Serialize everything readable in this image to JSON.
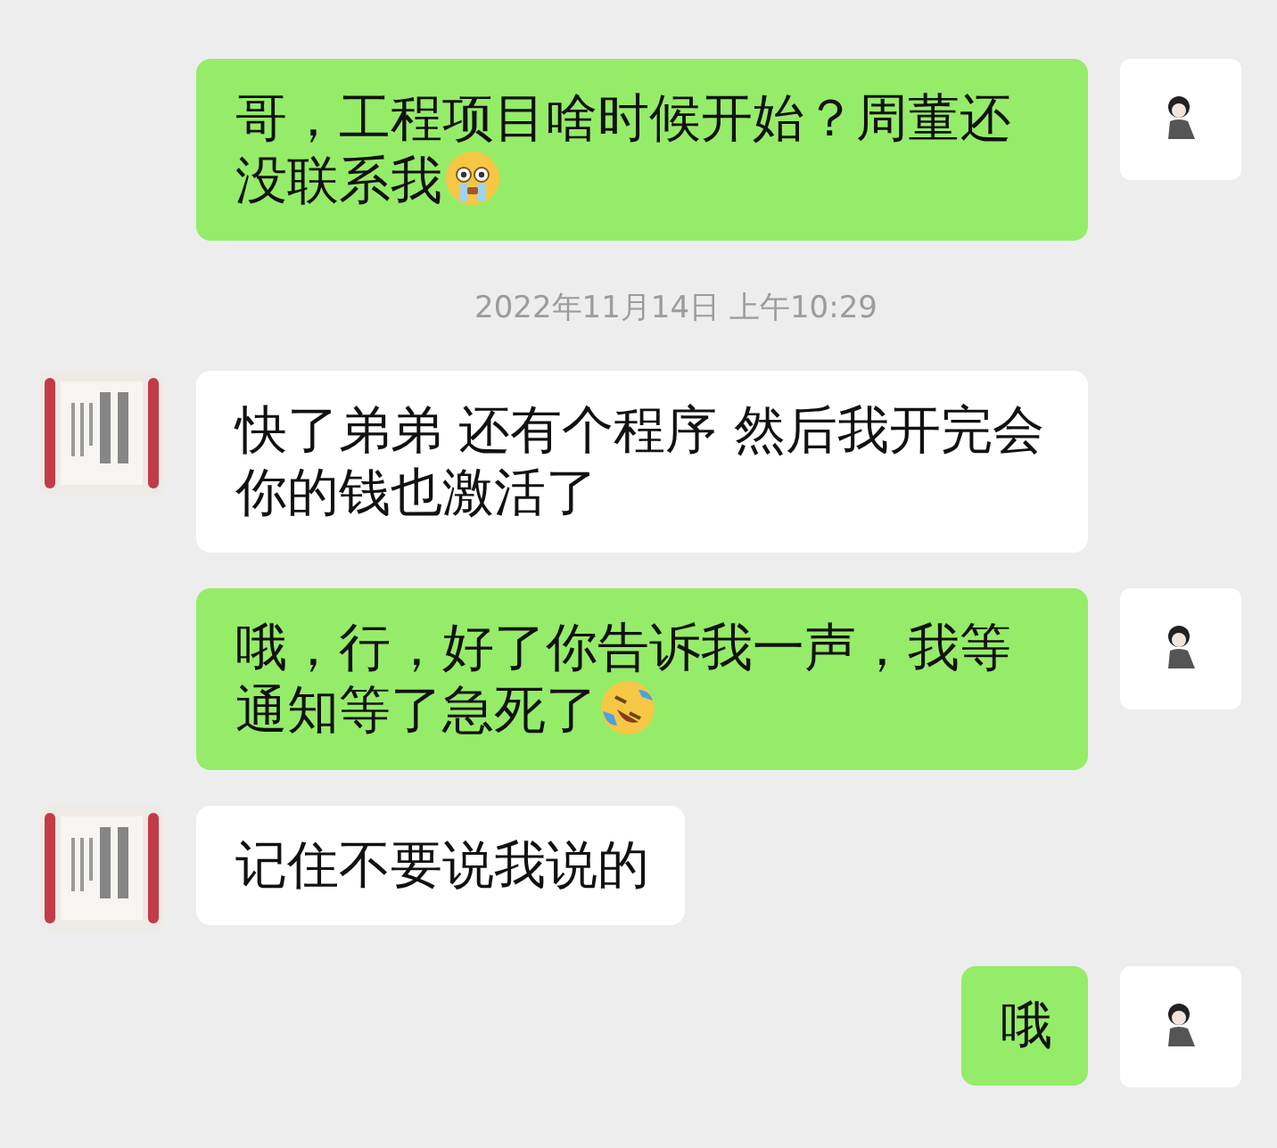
{
  "messages": [
    {
      "kind": "sent",
      "text": "哥，工程项目啥时候开始？周董还没联系我",
      "emoji": true
    },
    {
      "kind": "time",
      "text": "2022年11月14日 上午10:29"
    },
    {
      "kind": "received",
      "text": "快了弟弟 还有个程序 然后我开完会你的钱也激活了"
    },
    {
      "kind": "sent",
      "text": "哦，行，好了你告诉我一声，我等通知等了急死了",
      "emoji": true
    },
    {
      "kind": "received",
      "text": "记住不要说我说的"
    },
    {
      "kind": "sent",
      "text": "哦"
    }
  ]
}
